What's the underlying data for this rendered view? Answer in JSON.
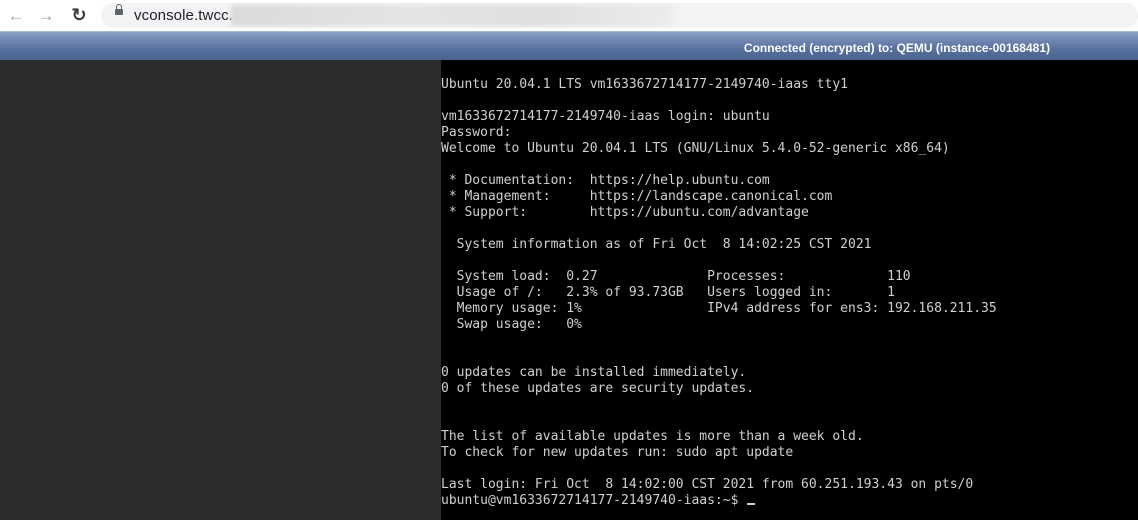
{
  "browser": {
    "back_icon": "arrow-left-icon",
    "forward_icon": "arrow-right-icon",
    "reload_icon": "reload-icon",
    "url": "vconsole.twcc."
  },
  "vnc": {
    "status": "Connected (encrypted) to: QEMU (instance-00168481)",
    "status_bar_color": "#58709d"
  },
  "terminal": {
    "lines": [
      "Ubuntu 20.04.1 LTS vm1633672714177-2149740-iaas tty1",
      "",
      "vm1633672714177-2149740-iaas login: ubuntu",
      "Password:",
      "Welcome to Ubuntu 20.04.1 LTS (GNU/Linux 5.4.0-52-generic x86_64)",
      "",
      " * Documentation:  https://help.ubuntu.com",
      " * Management:     https://landscape.canonical.com",
      " * Support:        https://ubuntu.com/advantage",
      "",
      "  System information as of Fri Oct  8 14:02:25 CST 2021",
      "",
      "  System load:  0.27              Processes:             110",
      "  Usage of /:   2.3% of 93.73GB   Users logged in:       1",
      "  Memory usage: 1%                IPv4 address for ens3: 192.168.211.35",
      "  Swap usage:   0%",
      "",
      "",
      "0 updates can be installed immediately.",
      "0 of these updates are security updates.",
      "",
      "",
      "The list of available updates is more than a week old.",
      "To check for new updates run: sudo apt update",
      "",
      "Last login: Fri Oct  8 14:02:00 CST 2021 from 60.251.193.43 on pts/0"
    ],
    "prompt": "ubuntu@vm1633672714177-2149740-iaas:~$ "
  }
}
